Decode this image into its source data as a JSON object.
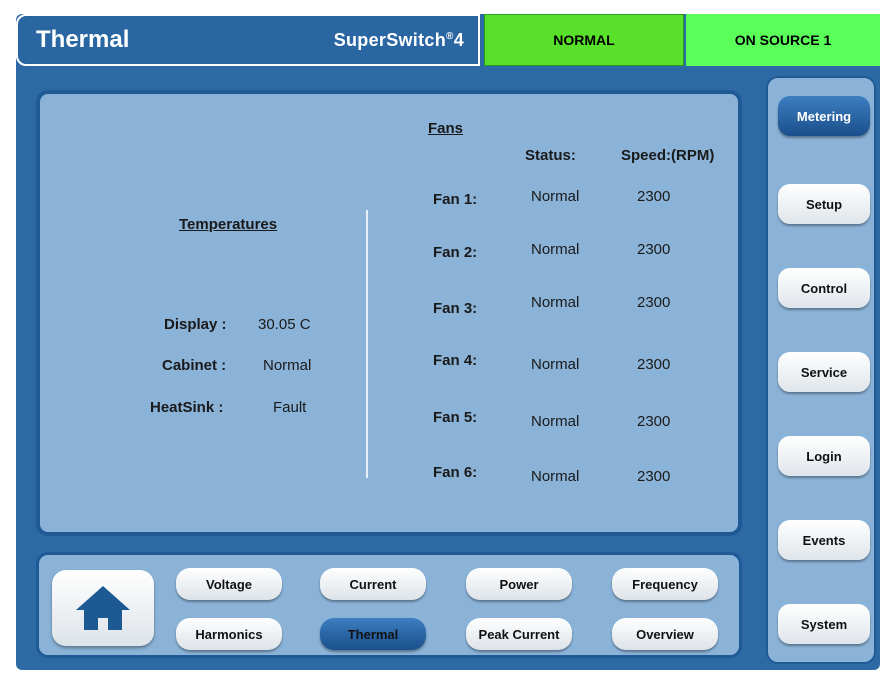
{
  "header": {
    "title": "Thermal",
    "brand": "SuperSwitch",
    "brand_suffix": "4",
    "status_mode": "NORMAL",
    "status_source": "ON SOURCE 1",
    "colors": {
      "mode_bg": "#58e02a",
      "source_bg": "#5aff5a",
      "title_bg": "#2a67a2"
    }
  },
  "temperatures": {
    "heading": "Temperatures",
    "rows": [
      {
        "label": "Display :",
        "value": "30.05  C"
      },
      {
        "label": "Cabinet :",
        "value": "Normal"
      },
      {
        "label": "HeatSink :",
        "value": "Fault"
      }
    ]
  },
  "fans": {
    "heading": "Fans",
    "status_header": "Status:",
    "speed_header": "Speed:(RPM)",
    "rows": [
      {
        "label": "Fan 1:",
        "status": "Normal",
        "speed": "2300"
      },
      {
        "label": "Fan 2:",
        "status": "Normal",
        "speed": "2300"
      },
      {
        "label": "Fan 3:",
        "status": "Normal",
        "speed": "2300"
      },
      {
        "label": "Fan 4:",
        "status": "Normal",
        "speed": "2300"
      },
      {
        "label": "Fan 5:",
        "status": "Normal",
        "speed": "2300"
      },
      {
        "label": "Fan 6:",
        "status": "Normal",
        "speed": "2300"
      }
    ]
  },
  "sidebar": {
    "items": [
      {
        "label": "Metering",
        "active": true
      },
      {
        "label": "Setup"
      },
      {
        "label": "Control"
      },
      {
        "label": "Service"
      },
      {
        "label": "Login"
      },
      {
        "label": "Events"
      },
      {
        "label": "System"
      }
    ]
  },
  "nav": {
    "home_icon": "home-icon",
    "items": [
      {
        "label": "Voltage"
      },
      {
        "label": "Current"
      },
      {
        "label": "Power"
      },
      {
        "label": "Frequency"
      },
      {
        "label": "Harmonics"
      },
      {
        "label": "Thermal",
        "active": true
      },
      {
        "label": "Peak Current"
      },
      {
        "label": "Overview"
      }
    ]
  }
}
